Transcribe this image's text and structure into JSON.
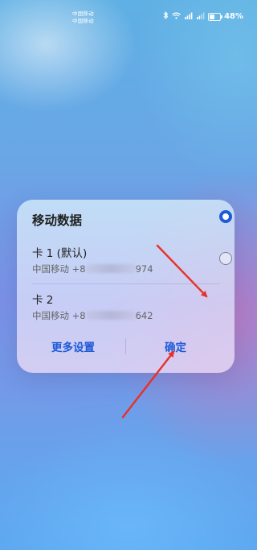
{
  "status_bar": {
    "carrier_line1": "中国移动",
    "carrier_line2": "中国移动",
    "icons": [
      "bluetooth-icon",
      "wifi-icon",
      "signal-4g-icon",
      "signal-4g-icon",
      "battery-icon"
    ],
    "battery_percent": "48%",
    "battery_level": 0.48
  },
  "dialog": {
    "title": "移动数据",
    "sims": [
      {
        "name": "卡 1 (默认)",
        "carrier": "中国移动 +8",
        "number_suffix": "974",
        "selected": true
      },
      {
        "name": "卡 2",
        "carrier": "中国移动 +8",
        "number_suffix": "642",
        "selected": false
      }
    ],
    "more_settings_label": "更多设置",
    "confirm_label": "确定"
  },
  "colors": {
    "accent": "#1e5bd8",
    "annotation_arrow": "#e8302a"
  }
}
